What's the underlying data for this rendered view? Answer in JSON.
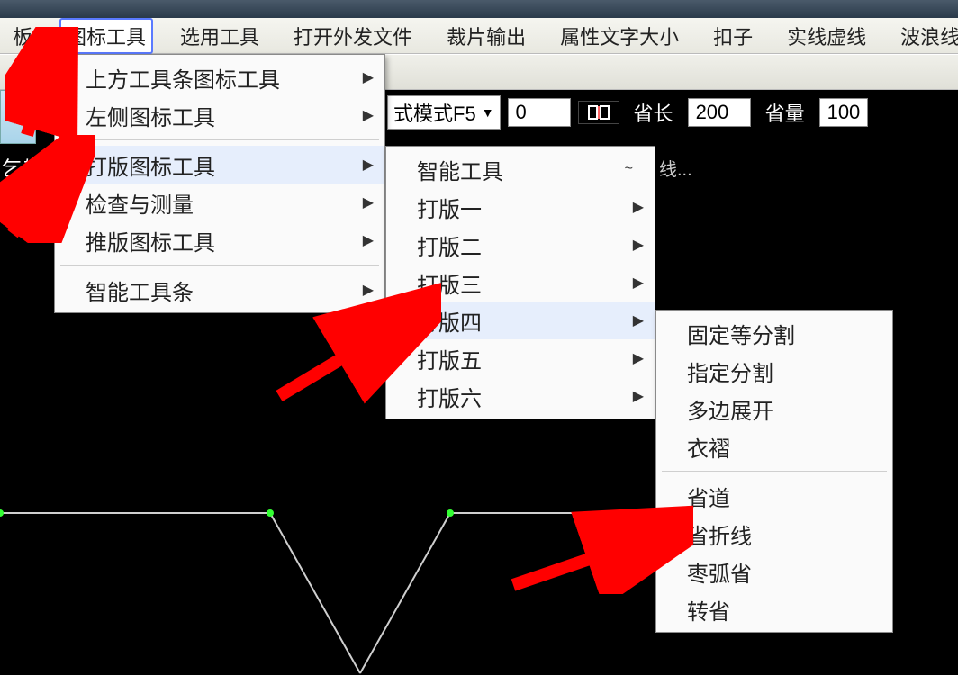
{
  "menubar": {
    "items": [
      "板",
      "图标工具",
      "选用工具",
      "打开外发文件",
      "裁片输出",
      "属性文字大小",
      "扣子",
      "实线虚线",
      "波浪线"
    ],
    "active_index": 1
  },
  "param_bar": {
    "combo_label": "式模式F5",
    "field0": "0",
    "label_len": "省长",
    "field_len": "200",
    "label_amt": "省量",
    "field_amt": "100"
  },
  "left_label": "乞输)",
  "status_right": "线...",
  "dropdown1": {
    "groups": [
      [
        "上方工具条图标工具",
        "左侧图标工具"
      ],
      [
        "打版图标工具",
        "检查与测量",
        "推版图标工具"
      ],
      [
        "智能工具条"
      ]
    ],
    "hover_index": 2
  },
  "dropdown2": {
    "items": [
      "智能工具",
      "打版一",
      "打版二",
      "打版三",
      "打版四",
      "打版五",
      "打版六"
    ],
    "tilde_index": 0,
    "hover_index": 4,
    "arrow_start_index": 1
  },
  "dropdown3": {
    "groups": [
      [
        "固定等分割",
        "指定分割",
        "多边展开",
        "衣褶"
      ],
      [
        "省道",
        "省折线",
        "枣弧省",
        "转省"
      ]
    ]
  }
}
